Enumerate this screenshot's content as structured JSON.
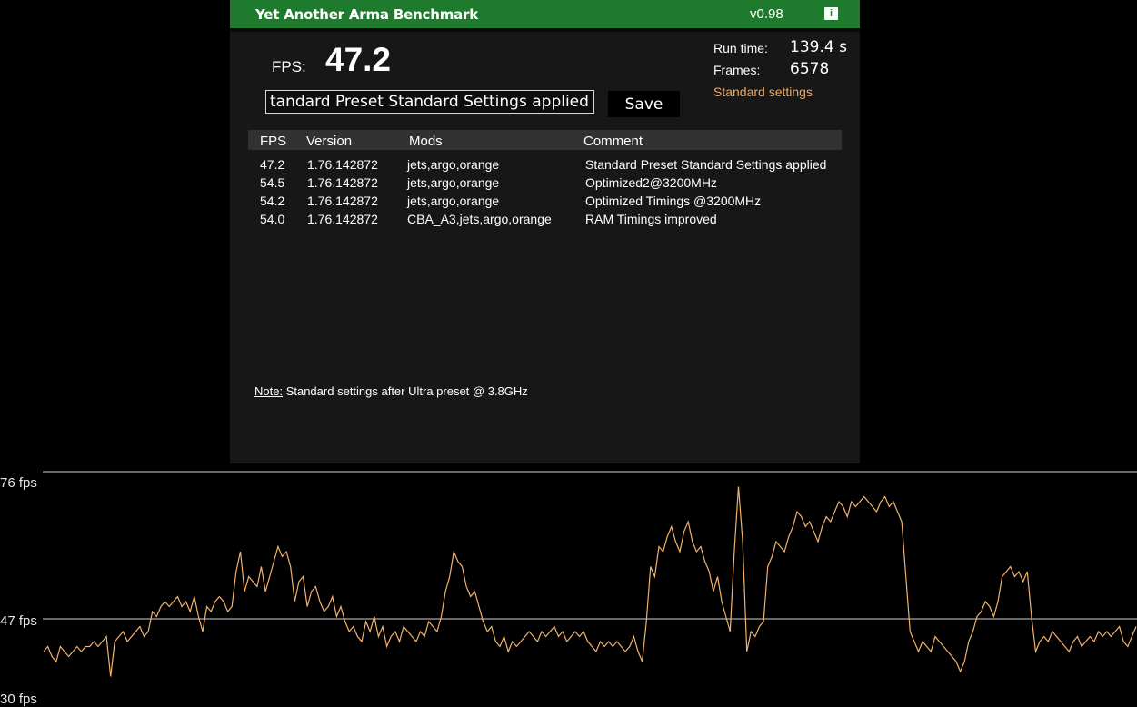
{
  "app": {
    "title": "Yet Another Arma Benchmark",
    "version": "v0.98",
    "info_icon": "info-icon"
  },
  "result": {
    "fps_label": "FPS:",
    "fps_value": "47.2",
    "comment_value": "tandard Preset Standard Settings applied",
    "save_label": "Save",
    "runtime_label": "Run time:",
    "runtime_value": "139.4 s",
    "frames_label": "Frames:",
    "frames_value": "6578",
    "settings_link": "Standard settings"
  },
  "table": {
    "headers": [
      "FPS",
      "Version",
      "Mods",
      "Comment"
    ],
    "rows": [
      {
        "fps": "47.2",
        "version": "1.76.142872",
        "mods": "jets,argo,orange",
        "comment": "Standard Preset Standard Settings applied"
      },
      {
        "fps": "54.5",
        "version": "1.76.142872",
        "mods": "jets,argo,orange",
        "comment": "Optimized2@3200MHz"
      },
      {
        "fps": "54.2",
        "version": "1.76.142872",
        "mods": "jets,argo,orange",
        "comment": "Optimized Timings @3200MHz"
      },
      {
        "fps": "54.0",
        "version": "1.76.142872",
        "mods": "CBA_A3,jets,argo,orange",
        "comment": "RAM Timings improved"
      }
    ]
  },
  "note": {
    "key": "Note:",
    "text": " Standard settings after Ultra preset @ 3.8GHz"
  },
  "graph": {
    "max_label": "76 fps",
    "avg_label": "47 fps",
    "min_label": "30 fps",
    "line_color": "#f2b36b",
    "chart_data": {
      "type": "line",
      "ylim": [
        30,
        76
      ],
      "reference_lines": [
        76,
        47
      ],
      "series": [
        {
          "values": [
            40,
            41,
            39,
            38,
            41,
            40,
            39,
            40,
            41,
            40,
            41,
            41,
            42,
            41,
            42,
            43,
            35,
            42,
            43,
            44,
            42,
            43,
            44,
            45,
            43,
            44,
            48,
            47,
            49,
            50,
            49,
            50,
            51,
            49,
            50,
            48,
            51,
            47,
            44,
            49,
            48,
            50,
            51,
            50,
            48,
            49,
            56,
            60,
            52,
            55,
            54,
            53,
            57,
            52,
            55,
            58,
            61,
            59,
            60,
            57,
            50,
            54,
            55,
            49,
            52,
            53,
            50,
            48,
            49,
            51,
            47,
            49,
            46,
            44,
            45,
            43,
            42,
            46,
            44,
            47,
            43,
            45,
            41,
            43,
            44,
            42,
            45,
            44,
            43,
            42,
            44,
            43,
            46,
            45,
            44,
            47,
            52,
            55,
            60,
            58,
            57,
            53,
            51,
            52,
            49,
            46,
            44,
            45,
            42,
            41,
            43,
            40,
            42,
            41,
            42,
            43,
            44,
            43,
            42,
            44,
            43,
            44,
            45,
            43,
            44,
            42,
            43,
            44,
            43,
            44,
            42,
            41,
            40,
            42,
            41,
            42,
            41,
            42,
            41,
            40,
            41,
            43,
            40,
            38,
            46,
            57,
            55,
            61,
            60,
            63,
            65,
            62,
            60,
            64,
            66,
            62,
            60,
            61,
            58,
            56,
            52,
            55,
            50,
            47,
            44,
            60,
            73,
            62,
            40,
            44,
            43,
            45,
            46,
            57,
            59,
            62,
            61,
            60,
            63,
            65,
            68,
            67,
            65,
            66,
            64,
            62,
            65,
            67,
            66,
            68,
            70,
            69,
            67,
            70,
            69,
            70,
            71,
            70,
            69,
            68,
            70,
            71,
            69,
            70,
            68,
            66,
            55,
            44,
            42,
            40,
            42,
            41,
            40,
            43,
            42,
            41,
            40,
            39,
            38,
            36,
            38,
            42,
            44,
            47,
            48,
            50,
            49,
            47,
            50,
            55,
            56,
            57,
            55,
            56,
            54,
            56,
            47,
            40,
            42,
            43,
            42,
            44,
            43,
            42,
            41,
            40,
            42,
            43,
            41,
            42,
            43,
            42,
            44,
            43,
            44,
            43,
            44,
            45,
            42,
            41,
            43,
            45
          ]
        }
      ]
    }
  }
}
